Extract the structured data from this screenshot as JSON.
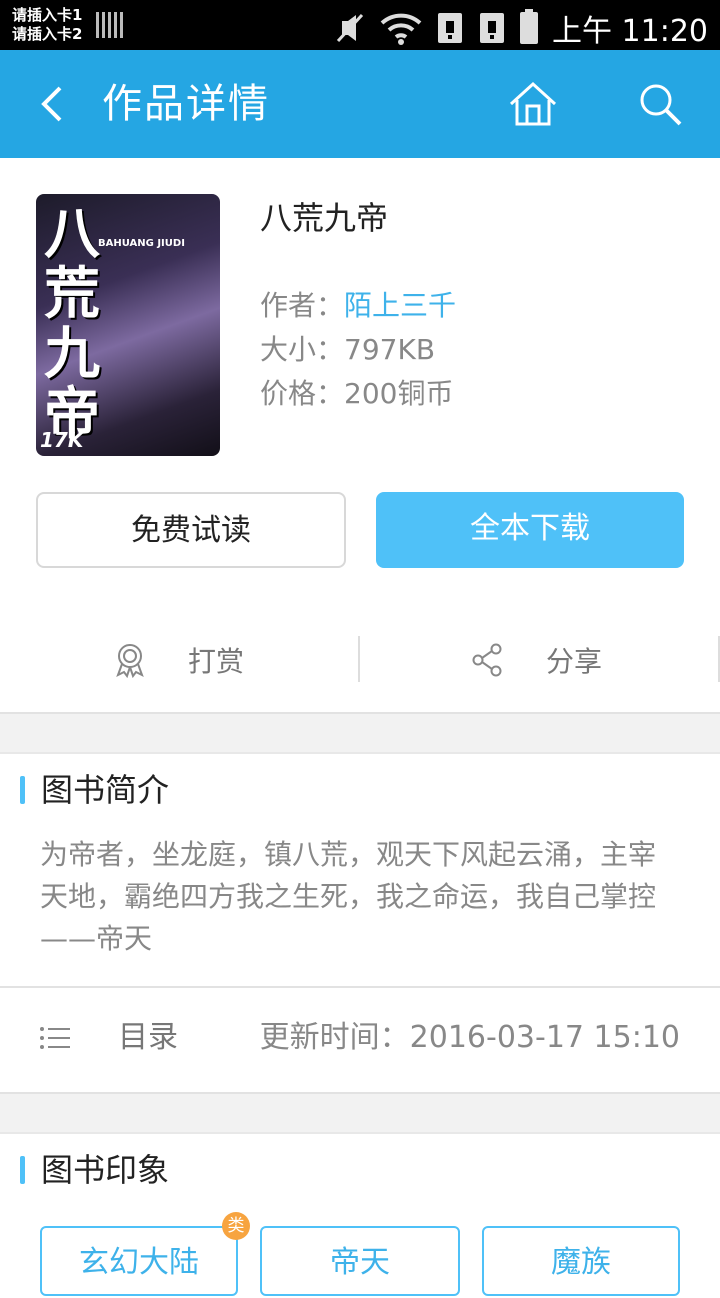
{
  "status_bar": {
    "sim1": "请插入卡1",
    "sim2": "请插入卡2",
    "time": "上午 11:20",
    "icons": [
      "signal-bars-icon",
      "mute-icon",
      "wifi-icon",
      "sim1-error-icon",
      "sim2-error-icon",
      "battery-icon"
    ]
  },
  "header": {
    "title": "作品详情",
    "back_icon": "back-arrow-icon",
    "home_icon": "home-icon",
    "search_icon": "search-icon"
  },
  "book": {
    "name": "八荒九帝",
    "cover": {
      "title": "八荒九帝",
      "en": "BAHUANG JIUDI",
      "brand": "17K"
    },
    "author_label": "作者：",
    "author": "陌上三千",
    "size_label": "大小：",
    "size": "797KB",
    "price_label": "价格：",
    "price": "200铜币"
  },
  "buttons": {
    "read": "免费试读",
    "download": "全本下载"
  },
  "actions": {
    "tip": "打赏",
    "share": "分享"
  },
  "intro": {
    "title": "图书简介",
    "text": "为帝者，坐龙庭，镇八荒，观天下风起云涌，主宰天地，霸绝四方我之生死，我之命运，我自己掌控——帝天"
  },
  "toc": {
    "label": "目录",
    "update": "更新时间：2016-03-17 15:10"
  },
  "impression": {
    "title": "图书印象",
    "badge": "类",
    "tags": [
      "玄幻大陆",
      "帝天",
      "魔族"
    ]
  },
  "colors": {
    "header_bg": "#25a6e3",
    "accent": "#4fc1f8",
    "link": "#3eb2ea",
    "badge": "#f7a440"
  }
}
